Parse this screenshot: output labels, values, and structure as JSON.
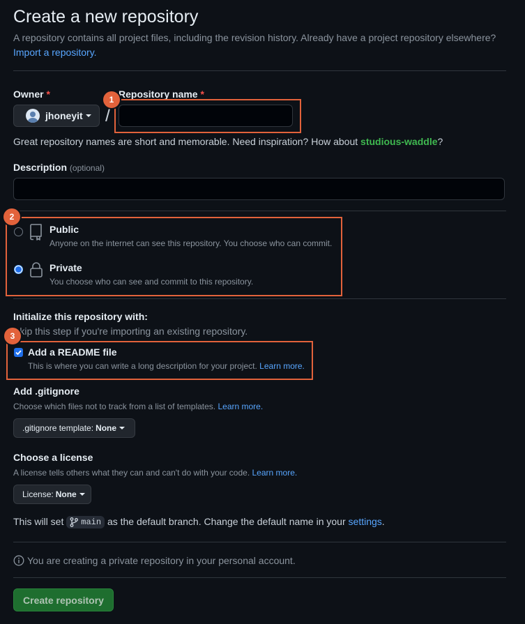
{
  "header": {
    "title": "Create a new repository",
    "subtitle": "A repository contains all project files, including the revision history. Already have a project repository elsewhere?",
    "import_link": "Import a repository."
  },
  "owner": {
    "label": "Owner",
    "required_mark": "*",
    "value": "jhoneyit"
  },
  "repo_name": {
    "label": "Repository name",
    "required_mark": "*",
    "value": "",
    "slash": "/"
  },
  "name_hint": {
    "prefix": "Great repository names are short and memorable. Need inspiration? How about ",
    "suggestion": "studious-waddle",
    "suffix": "?"
  },
  "description": {
    "label": "Description",
    "optional": "(optional)",
    "value": ""
  },
  "visibility": {
    "options": [
      {
        "label": "Public",
        "desc": "Anyone on the internet can see this repository. You choose who can commit.",
        "checked": false
      },
      {
        "label": "Private",
        "desc": "You choose who can see and commit to this repository.",
        "checked": true
      }
    ]
  },
  "init": {
    "heading": "Initialize this repository with:",
    "hint": "Skip this step if you're importing an existing repository.",
    "readme_label": "Add a README file",
    "readme_desc": "This is where you can write a long description for your project.",
    "readme_link": "Learn more.",
    "readme_checked": true
  },
  "gitignore": {
    "label": "Add .gitignore",
    "desc": "Choose which files not to track from a list of templates.",
    "link": "Learn more.",
    "button_prefix": ".gitignore template:",
    "button_value": "None"
  },
  "license": {
    "label": "Choose a license",
    "desc": "A license tells others what they can and can't do with your code.",
    "link": "Learn more.",
    "button_prefix": "License:",
    "button_value": "None"
  },
  "branch": {
    "prefix": "This will set",
    "name": "main",
    "middle": "as the default branch. Change the default name in your",
    "settings_link": "settings",
    "suffix": "."
  },
  "notice": "You are creating a private repository in your personal account.",
  "submit_label": "Create repository",
  "annotations": [
    "1",
    "2",
    "3"
  ],
  "colors": {
    "background": "#0d1117",
    "accent": "#58a6ff",
    "annotation": "#e2623b",
    "primary_button": "#238636",
    "suggestion": "#3fb950"
  }
}
